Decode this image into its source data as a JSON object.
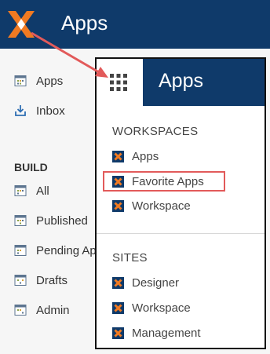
{
  "header": {
    "title": "Apps"
  },
  "sidebar": {
    "items": [
      {
        "label": "Apps"
      },
      {
        "label": "Inbox"
      }
    ],
    "build_heading": "BUILD",
    "build_items": [
      {
        "label": "All"
      },
      {
        "label": "Published"
      },
      {
        "label": "Pending Ap"
      },
      {
        "label": "Drafts"
      },
      {
        "label": "Admin"
      }
    ]
  },
  "panel": {
    "title": "Apps",
    "workspaces_heading": "WORKSPACES",
    "workspaces": [
      {
        "label": "Apps"
      },
      {
        "label": "Favorite Apps"
      },
      {
        "label": "Workspace"
      }
    ],
    "sites_heading": "SITES",
    "sites": [
      {
        "label": "Designer"
      },
      {
        "label": "Workspace"
      },
      {
        "label": "Management"
      }
    ]
  },
  "colors": {
    "brand_navy": "#0f3a6a",
    "logo_orange": "#f07a22",
    "annotation_red": "#e25a5a"
  }
}
